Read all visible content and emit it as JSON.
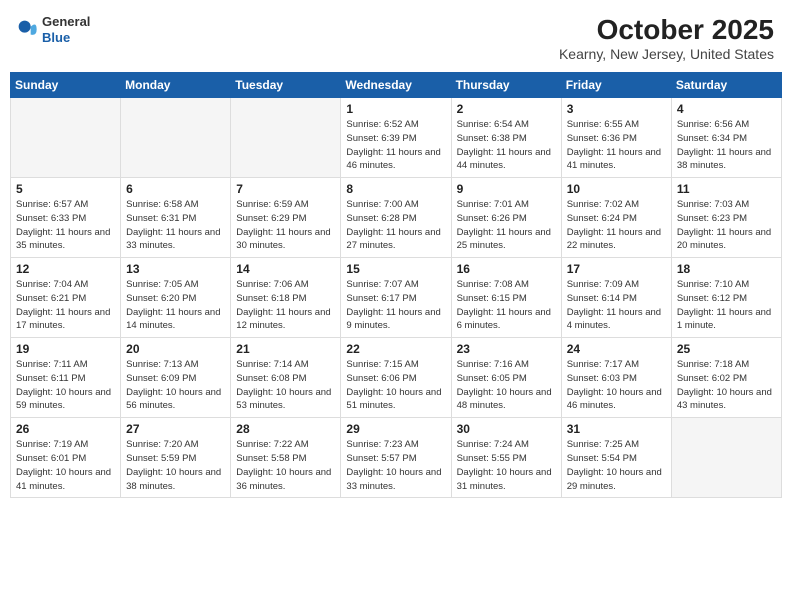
{
  "header": {
    "logo_general": "General",
    "logo_blue": "Blue",
    "month_title": "October 2025",
    "location": "Kearny, New Jersey, United States"
  },
  "days_of_week": [
    "Sunday",
    "Monday",
    "Tuesday",
    "Wednesday",
    "Thursday",
    "Friday",
    "Saturday"
  ],
  "weeks": [
    [
      {
        "day": "",
        "empty": true
      },
      {
        "day": "",
        "empty": true
      },
      {
        "day": "",
        "empty": true
      },
      {
        "day": "1",
        "sunrise": "6:52 AM",
        "sunset": "6:39 PM",
        "daylight": "11 hours and 46 minutes."
      },
      {
        "day": "2",
        "sunrise": "6:54 AM",
        "sunset": "6:38 PM",
        "daylight": "11 hours and 44 minutes."
      },
      {
        "day": "3",
        "sunrise": "6:55 AM",
        "sunset": "6:36 PM",
        "daylight": "11 hours and 41 minutes."
      },
      {
        "day": "4",
        "sunrise": "6:56 AM",
        "sunset": "6:34 PM",
        "daylight": "11 hours and 38 minutes."
      }
    ],
    [
      {
        "day": "5",
        "sunrise": "6:57 AM",
        "sunset": "6:33 PM",
        "daylight": "11 hours and 35 minutes."
      },
      {
        "day": "6",
        "sunrise": "6:58 AM",
        "sunset": "6:31 PM",
        "daylight": "11 hours and 33 minutes."
      },
      {
        "day": "7",
        "sunrise": "6:59 AM",
        "sunset": "6:29 PM",
        "daylight": "11 hours and 30 minutes."
      },
      {
        "day": "8",
        "sunrise": "7:00 AM",
        "sunset": "6:28 PM",
        "daylight": "11 hours and 27 minutes."
      },
      {
        "day": "9",
        "sunrise": "7:01 AM",
        "sunset": "6:26 PM",
        "daylight": "11 hours and 25 minutes."
      },
      {
        "day": "10",
        "sunrise": "7:02 AM",
        "sunset": "6:24 PM",
        "daylight": "11 hours and 22 minutes."
      },
      {
        "day": "11",
        "sunrise": "7:03 AM",
        "sunset": "6:23 PM",
        "daylight": "11 hours and 20 minutes."
      }
    ],
    [
      {
        "day": "12",
        "sunrise": "7:04 AM",
        "sunset": "6:21 PM",
        "daylight": "11 hours and 17 minutes."
      },
      {
        "day": "13",
        "sunrise": "7:05 AM",
        "sunset": "6:20 PM",
        "daylight": "11 hours and 14 minutes."
      },
      {
        "day": "14",
        "sunrise": "7:06 AM",
        "sunset": "6:18 PM",
        "daylight": "11 hours and 12 minutes."
      },
      {
        "day": "15",
        "sunrise": "7:07 AM",
        "sunset": "6:17 PM",
        "daylight": "11 hours and 9 minutes."
      },
      {
        "day": "16",
        "sunrise": "7:08 AM",
        "sunset": "6:15 PM",
        "daylight": "11 hours and 6 minutes."
      },
      {
        "day": "17",
        "sunrise": "7:09 AM",
        "sunset": "6:14 PM",
        "daylight": "11 hours and 4 minutes."
      },
      {
        "day": "18",
        "sunrise": "7:10 AM",
        "sunset": "6:12 PM",
        "daylight": "11 hours and 1 minute."
      }
    ],
    [
      {
        "day": "19",
        "sunrise": "7:11 AM",
        "sunset": "6:11 PM",
        "daylight": "10 hours and 59 minutes."
      },
      {
        "day": "20",
        "sunrise": "7:13 AM",
        "sunset": "6:09 PM",
        "daylight": "10 hours and 56 minutes."
      },
      {
        "day": "21",
        "sunrise": "7:14 AM",
        "sunset": "6:08 PM",
        "daylight": "10 hours and 53 minutes."
      },
      {
        "day": "22",
        "sunrise": "7:15 AM",
        "sunset": "6:06 PM",
        "daylight": "10 hours and 51 minutes."
      },
      {
        "day": "23",
        "sunrise": "7:16 AM",
        "sunset": "6:05 PM",
        "daylight": "10 hours and 48 minutes."
      },
      {
        "day": "24",
        "sunrise": "7:17 AM",
        "sunset": "6:03 PM",
        "daylight": "10 hours and 46 minutes."
      },
      {
        "day": "25",
        "sunrise": "7:18 AM",
        "sunset": "6:02 PM",
        "daylight": "10 hours and 43 minutes."
      }
    ],
    [
      {
        "day": "26",
        "sunrise": "7:19 AM",
        "sunset": "6:01 PM",
        "daylight": "10 hours and 41 minutes."
      },
      {
        "day": "27",
        "sunrise": "7:20 AM",
        "sunset": "5:59 PM",
        "daylight": "10 hours and 38 minutes."
      },
      {
        "day": "28",
        "sunrise": "7:22 AM",
        "sunset": "5:58 PM",
        "daylight": "10 hours and 36 minutes."
      },
      {
        "day": "29",
        "sunrise": "7:23 AM",
        "sunset": "5:57 PM",
        "daylight": "10 hours and 33 minutes."
      },
      {
        "day": "30",
        "sunrise": "7:24 AM",
        "sunset": "5:55 PM",
        "daylight": "10 hours and 31 minutes."
      },
      {
        "day": "31",
        "sunrise": "7:25 AM",
        "sunset": "5:54 PM",
        "daylight": "10 hours and 29 minutes."
      },
      {
        "day": "",
        "empty": true
      }
    ]
  ]
}
